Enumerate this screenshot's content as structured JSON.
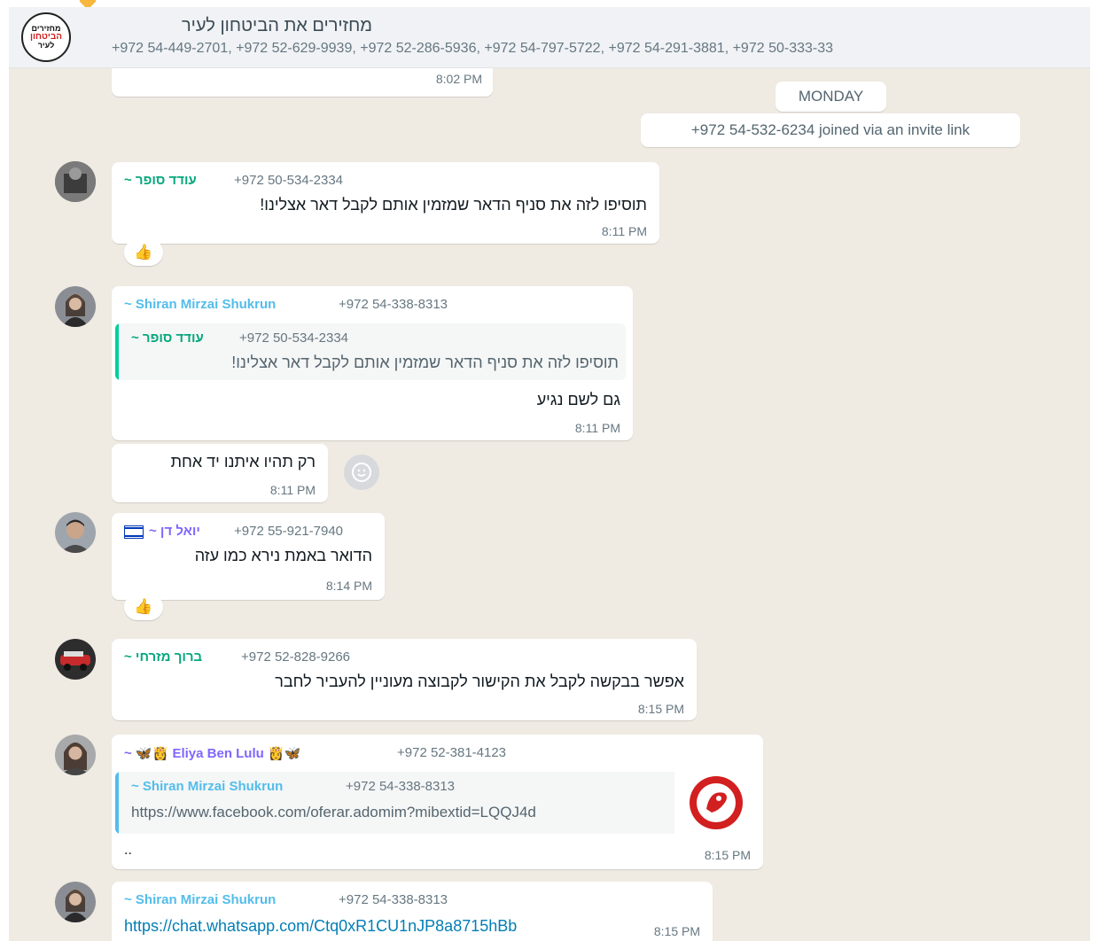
{
  "header": {
    "title": "מחזירים את הביטחון לעיר",
    "members": "+972 54-449-2701, +972 52-629-9939, +972 52-286-5936, +972 54-797-5722, +972 54-291-3881, +972 50-333-33",
    "avatar_line1": "מחזירים",
    "avatar_line2": "הביטחון",
    "avatar_line3": "לעיר"
  },
  "chat": {
    "prev_time": "8:02 PM",
    "day_label": "MONDAY",
    "system_join": "+972 54-532-6234 joined via an invite link",
    "messages": [
      {
        "sender": "עודד סופר ~",
        "phone": "+972 50-534-2334",
        "text": "תוסיפו לזה את סניף הדאר שמזמין אותם לקבל דאר אצלינו!",
        "time": "8:11 PM",
        "reaction": "👍"
      },
      {
        "sender": "~ Shiran Mirzai Shukrun",
        "phone": "+972 54-338-8313",
        "quote_sender": "עודד סופר ~",
        "quote_phone": "+972 50-534-2334",
        "quote_text": "תוסיפו לזה את סניף הדאר שמזמין אותם לקבל דאר אצלינו!",
        "text": "גם לשם נגיע",
        "time": "8:11 PM"
      },
      {
        "text": "רק תהיו איתנו יד אחת",
        "time": "8:11 PM"
      },
      {
        "sender": "יואל דן ~",
        "phone": "+972 55-921-7940",
        "text": "הדואר באמת נירא כמו עזה",
        "time": "8:14 PM",
        "reaction": "👍"
      },
      {
        "sender": "ברוך מזרחי ~",
        "phone": "+972 52-828-9266",
        "text": "אפשר בבקשה לקבל את הקישור לקבוצה מעוניין להעביר לחבר",
        "time": "8:15 PM"
      },
      {
        "sender": "~ 🦋👸 Eliya Ben Lulu 👸🦋",
        "phone": "+972 52-381-4123",
        "quote_sender": "~ Shiran Mirzai Shukrun",
        "quote_phone": "+972 54-338-8313",
        "quote_text": "https://www.facebook.com/oferar.adomim?mibextid=LQQJ4d",
        "text": "..",
        "time": "8:15 PM"
      },
      {
        "sender": "~ Shiran Mirzai Shukrun",
        "phone": "+972 54-338-8313",
        "text": "https://chat.whatsapp.com/Ctq0xR1CU1nJP8a8715hBb",
        "time": "8:15 PM"
      }
    ]
  },
  "colors": {
    "chat_bg": "#efeae2",
    "sender_teal": "#06a77d",
    "sender_blue": "#53bdeb",
    "sender_purple": "#7f66ff",
    "quote_bar_green": "#06cf9c",
    "quote_bar_blue": "#53bdeb",
    "link_blue": "#027eb5"
  }
}
